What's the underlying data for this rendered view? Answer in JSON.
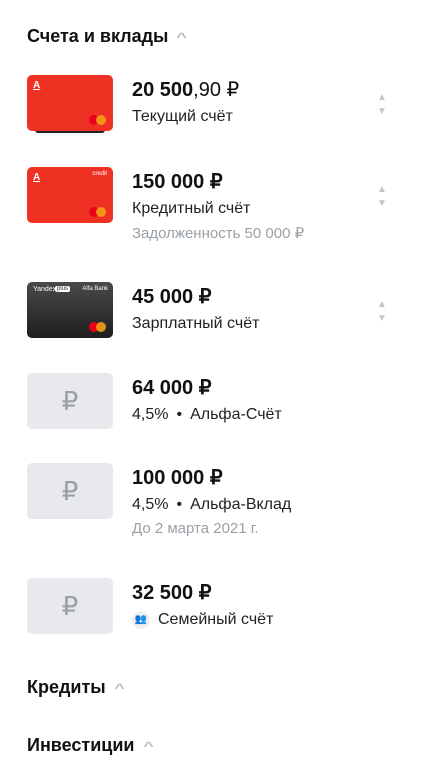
{
  "sections": {
    "accounts": "Счета и вклады",
    "credits": "Кредиты",
    "investments": "Инвестиции"
  },
  "card_labels": {
    "credit": "credit",
    "yandex": "Yandex",
    "plus": "plus",
    "alfa": "Alfa Bank",
    "alfa_letter": "А"
  },
  "currency_icon": "₽",
  "accounts": [
    {
      "amount_int": "20 500",
      "amount_frac": ",90 ₽",
      "name": "Текущий счёт"
    },
    {
      "amount": "150 000 ₽",
      "name": "Кредитный счёт",
      "note": "Задолженность 50 000 ₽"
    },
    {
      "amount": "45 000 ₽",
      "name": "Зарплатный счёт"
    },
    {
      "amount": "64 000 ₽",
      "rate": "4,5%",
      "name": "Альфа-Счёт"
    },
    {
      "amount": "100 000 ₽",
      "rate": "4,5%",
      "name": "Альфа-Вклад",
      "note": "До 2 марта 2021 г."
    },
    {
      "amount": "32 500 ₽",
      "name": "Семейный счёт"
    }
  ]
}
